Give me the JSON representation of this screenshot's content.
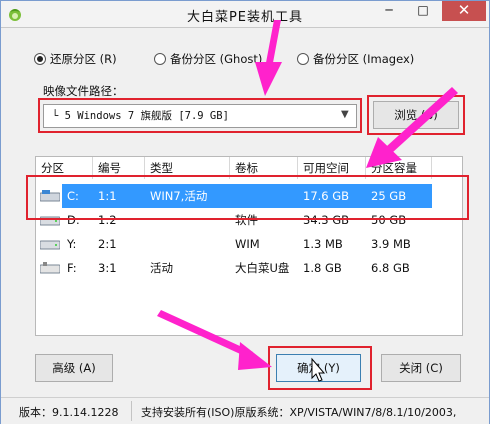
{
  "window": {
    "title": "大白菜PE装机工具",
    "min_label": "─",
    "max_label": "□",
    "close_label": "✕"
  },
  "mode_options": [
    {
      "label": "还原分区 (R)",
      "selected": true
    },
    {
      "label": "备份分区 (Ghost)",
      "selected": false
    },
    {
      "label": "备份分区 (Imagex)",
      "selected": false
    }
  ],
  "image_path": {
    "label": "映像文件路径：",
    "value": "└ 5 Windows 7 旗舰版 [7.9 GB]",
    "browse_label": "浏览 (B)"
  },
  "table": {
    "columns": [
      "分区",
      "编号",
      "类型",
      "卷标",
      "可用空间",
      "分区容量"
    ],
    "rows": [
      {
        "drive": "C:",
        "num": "1:1",
        "type": "WIN7,活动",
        "label": "",
        "free": "17.6 GB",
        "size": "25 GB",
        "selected": true,
        "icon": "windows-drive-icon"
      },
      {
        "drive": "D:",
        "num": "1:2",
        "type": "",
        "label": "软件",
        "free": "34.3 GB",
        "size": "50 GB",
        "selected": false,
        "icon": "hard-drive-icon"
      },
      {
        "drive": "Y:",
        "num": "2:1",
        "type": "",
        "label": "WIM",
        "free": "1.3 MB",
        "size": "3.9 MB",
        "selected": false,
        "icon": "hard-drive-icon"
      },
      {
        "drive": "F:",
        "num": "3:1",
        "type": "活动",
        "label": "大白菜U盘",
        "free": "1.8 GB",
        "size": "6.8 GB",
        "selected": false,
        "icon": "usb-drive-icon"
      }
    ]
  },
  "buttons": {
    "advanced": "高级 (A)",
    "ok": "确定 (Y)",
    "close": "关闭 (C)"
  },
  "status": {
    "version": "版本：9.1.14.1228",
    "support": "支持安装所有(ISO)原版系统：XP/VISTA/WIN7/8/8.1/10/2003,"
  },
  "colors": {
    "annotation": "#ff22cc",
    "highlight_box": "#e0222e",
    "selection": "#3399ff"
  }
}
